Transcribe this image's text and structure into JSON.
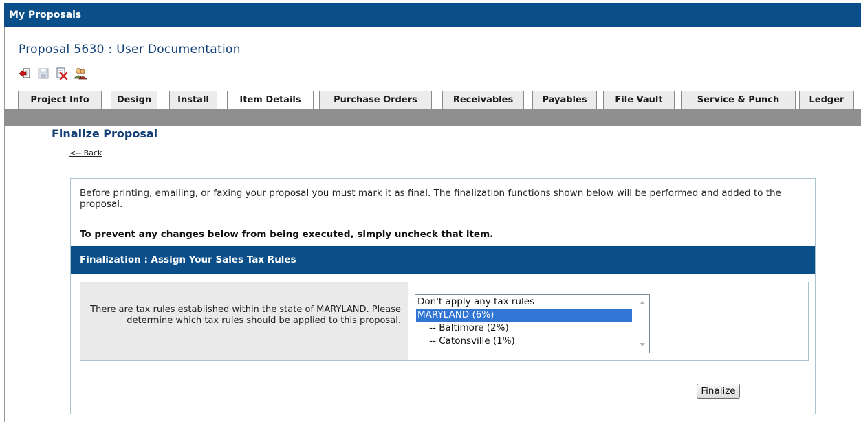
{
  "topbar": {
    "title": "My Proposals"
  },
  "proposal": {
    "title": "Proposal 5630 : User Documentation"
  },
  "toolbar": {
    "icons": [
      "exit-icon",
      "save-icon",
      "delete-icon",
      "users-icon"
    ]
  },
  "tabs": [
    {
      "label": "Project Info"
    },
    {
      "label": "Design"
    },
    {
      "label": "Install"
    },
    {
      "label": "Item Details",
      "active": true
    },
    {
      "label": "Purchase Orders"
    },
    {
      "label": "Receivables"
    },
    {
      "label": "Payables"
    },
    {
      "label": "File Vault"
    },
    {
      "label": "Service & Punch"
    },
    {
      "label": "Ledger"
    }
  ],
  "page": {
    "section_title": "Finalize Proposal",
    "back_link": "<-- Back"
  },
  "panel": {
    "intro": "Before printing, emailing, or faxing your proposal you must mark it as final. The finalization functions shown below will be performed and added to the proposal.",
    "instruction": "To prevent any changes below from being executed, simply uncheck that item.",
    "header": "Finalization : Assign Your Sales Tax Rules",
    "tax_text": "There are tax rules established within the state of MARYLAND. Please determine which tax rules should be applied to this proposal.",
    "tax_options": [
      "Don't apply any tax rules",
      "MARYLAND (6%)",
      "    -- Baltimore (2%)",
      "    -- Catonsville (1%)"
    ],
    "selected_option": "MARYLAND (6%)",
    "finalize_label": "Finalize"
  },
  "colors": {
    "brand_blue": "#0b4f8a",
    "title_blue": "#123f75",
    "selection_blue": "#3176d4",
    "tab_strip_gray": "#8f8f8f"
  }
}
